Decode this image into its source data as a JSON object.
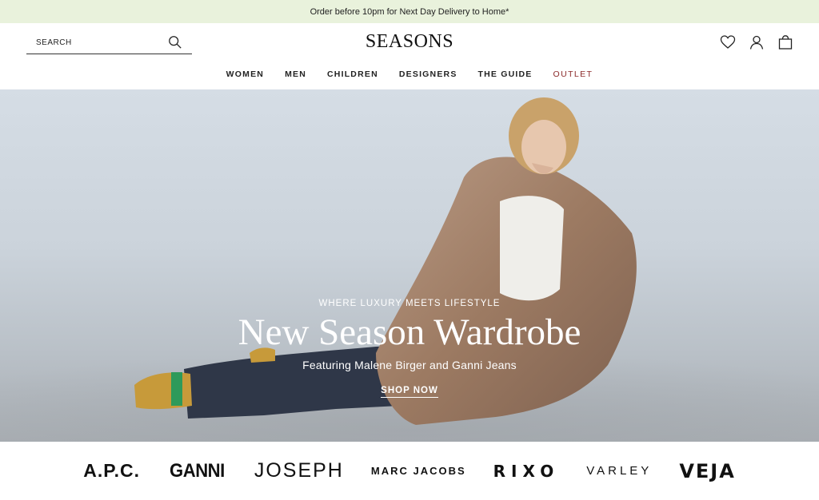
{
  "promo": {
    "text": "Order before 10pm for Next Day Delivery to Home*"
  },
  "header": {
    "search_placeholder": "SEARCH",
    "logo": "SEASONS",
    "icons": [
      "heart-icon",
      "user-icon",
      "shopping-bag-icon"
    ]
  },
  "nav": {
    "items": [
      {
        "label": "WOMEN"
      },
      {
        "label": "MEN"
      },
      {
        "label": "CHILDREN"
      },
      {
        "label": "DESIGNERS"
      },
      {
        "label": "THE GUIDE"
      },
      {
        "label": "OUTLET"
      }
    ],
    "outlet_color": "#8b2a2a"
  },
  "hero": {
    "eyebrow": "WHERE LUXURY MEETS LIFESTYLE",
    "title": "New Season Wardrobe",
    "subtitle": "Featuring Malene Birger and Ganni Jeans",
    "cta": "SHOP NOW"
  },
  "brands": [
    {
      "name": "A.P.C."
    },
    {
      "name": "GANNI"
    },
    {
      "name": "JOSEPH"
    },
    {
      "name": "MARC JACOBS"
    },
    {
      "name": "RIXO"
    },
    {
      "name": "VARLEY"
    },
    {
      "name": "VEJA"
    }
  ],
  "colors": {
    "promo_bg": "#e9f2dc",
    "text": "#1a1a1a",
    "hero_bg": "#cbd3db"
  }
}
